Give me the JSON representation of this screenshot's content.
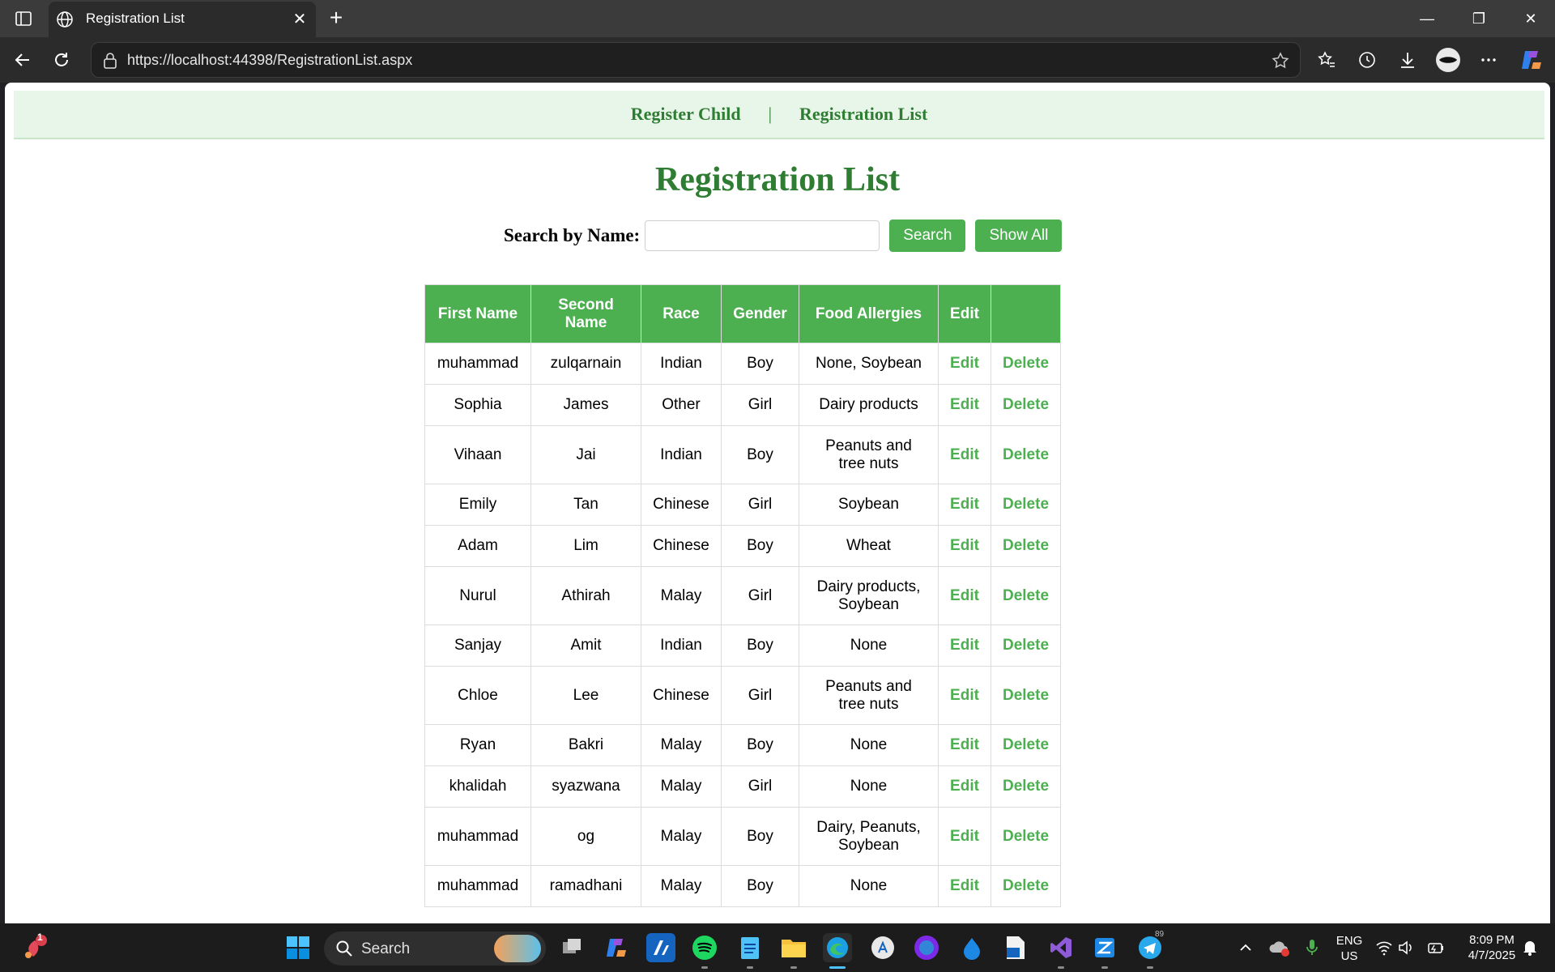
{
  "browser": {
    "tab_title": "Registration List",
    "url": "https://localhost:44398/RegistrationList.aspx"
  },
  "nav": {
    "register_child": "Register Child",
    "separator": "|",
    "registration_list": "Registration List"
  },
  "page": {
    "title": "Registration List",
    "search_label": "Search by Name:",
    "search_value": "",
    "search_button": "Search",
    "show_all_button": "Show All"
  },
  "table": {
    "headers": [
      "First Name",
      "Second Name",
      "Race",
      "Gender",
      "Food Allergies",
      "Edit",
      ""
    ],
    "edit_label": "Edit",
    "delete_label": "Delete",
    "rows": [
      {
        "first": "muhammad",
        "second": "zulqarnain",
        "race": "Indian",
        "gender": "Boy",
        "allergies": "None, Soybean"
      },
      {
        "first": "Sophia",
        "second": "James",
        "race": "Other",
        "gender": "Girl",
        "allergies": "Dairy products"
      },
      {
        "first": "Vihaan",
        "second": "Jai",
        "race": "Indian",
        "gender": "Boy",
        "allergies": "Peanuts and tree nuts"
      },
      {
        "first": "Emily",
        "second": "Tan",
        "race": "Chinese",
        "gender": "Girl",
        "allergies": "Soybean"
      },
      {
        "first": "Adam",
        "second": "Lim",
        "race": "Chinese",
        "gender": "Boy",
        "allergies": "Wheat"
      },
      {
        "first": "Nurul",
        "second": "Athirah",
        "race": "Malay",
        "gender": "Girl",
        "allergies": "Dairy products, Soybean"
      },
      {
        "first": "Sanjay",
        "second": "Amit",
        "race": "Indian",
        "gender": "Boy",
        "allergies": "None"
      },
      {
        "first": "Chloe",
        "second": "Lee",
        "race": "Chinese",
        "gender": "Girl",
        "allergies": "Peanuts and tree nuts"
      },
      {
        "first": "Ryan",
        "second": "Bakri",
        "race": "Malay",
        "gender": "Boy",
        "allergies": "None"
      },
      {
        "first": "khalidah",
        "second": "syazwana",
        "race": "Malay",
        "gender": "Girl",
        "allergies": "None"
      },
      {
        "first": "muhammad",
        "second": "og",
        "race": "Malay",
        "gender": "Boy",
        "allergies": "Dairy, Peanuts, Soybean"
      },
      {
        "first": "muhammad",
        "second": "ramadhani",
        "race": "Malay",
        "gender": "Boy",
        "allergies": "None"
      }
    ]
  },
  "taskbar": {
    "search_label": "Search",
    "notification_count": "1",
    "telegram_badge": "89",
    "language": "ENG",
    "region": "US",
    "time": "8:09 PM",
    "date": "4/7/2025"
  },
  "colors": {
    "accent_green": "#4caf50",
    "dark_green": "#2e7d32",
    "nav_bg": "#e8f5e9"
  }
}
